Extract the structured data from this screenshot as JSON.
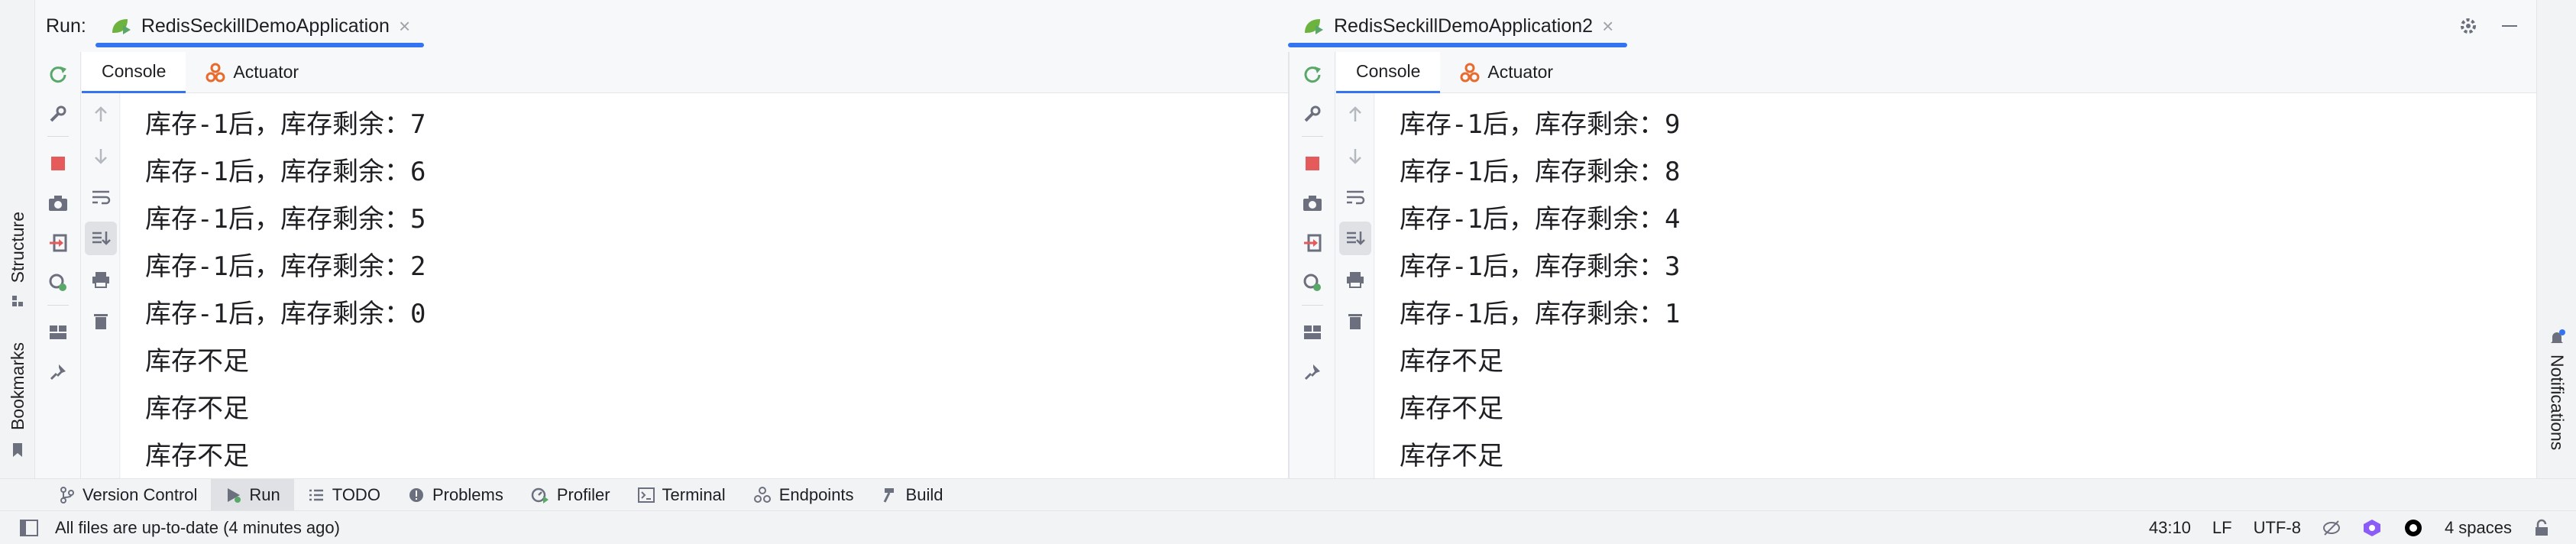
{
  "run": {
    "label": "Run:",
    "tabs": [
      {
        "title": "RedisSeckillDemoApplication",
        "icon": "spring-run-icon"
      },
      {
        "title": "RedisSeckillDemoApplication2",
        "icon": "spring-run-icon"
      }
    ]
  },
  "side": {
    "left_tabs": [
      {
        "label": "Structure",
        "icon": "structure-icon"
      },
      {
        "label": "Bookmarks",
        "icon": "bookmark-icon"
      }
    ],
    "right_tabs": [
      {
        "label": "Notifications",
        "icon": "bell-icon"
      }
    ]
  },
  "subtabs": {
    "console": "Console",
    "actuator": "Actuator"
  },
  "panes": [
    {
      "lines": [
        "库存-1后，库存剩余：7",
        "库存-1后，库存剩余：6",
        "库存-1后，库存剩余：5",
        "库存-1后，库存剩余：2",
        "库存-1后，库存剩余：0",
        "库存不足",
        "库存不足",
        "库存不足"
      ]
    },
    {
      "lines": [
        "库存-1后，库存剩余：9",
        "库存-1后，库存剩余：8",
        "库存-1后，库存剩余：4",
        "库存-1后，库存剩余：3",
        "库存-1后，库存剩余：1",
        "库存不足",
        "库存不足",
        "库存不足"
      ]
    }
  ],
  "bottom_tools": [
    {
      "label": "Version Control",
      "icon": "git-branch-icon"
    },
    {
      "label": "Run",
      "icon": "run-icon",
      "selected": true
    },
    {
      "label": "TODO",
      "icon": "todo-list-icon"
    },
    {
      "label": "Problems",
      "icon": "problems-icon"
    },
    {
      "label": "Profiler",
      "icon": "profiler-icon"
    },
    {
      "label": "Terminal",
      "icon": "terminal-icon"
    },
    {
      "label": "Endpoints",
      "icon": "endpoints-icon"
    },
    {
      "label": "Build",
      "icon": "hammer-icon"
    }
  ],
  "status": {
    "message": "All files are up-to-date (4 minutes ago)",
    "position": "43:10",
    "line_sep": "LF",
    "encoding": "UTF-8",
    "indent": "4 spaces"
  },
  "colors": {
    "accent": "#3574f0",
    "stop": "#e55b5b",
    "run_green": "#59a869",
    "spring": "#6db33f"
  }
}
